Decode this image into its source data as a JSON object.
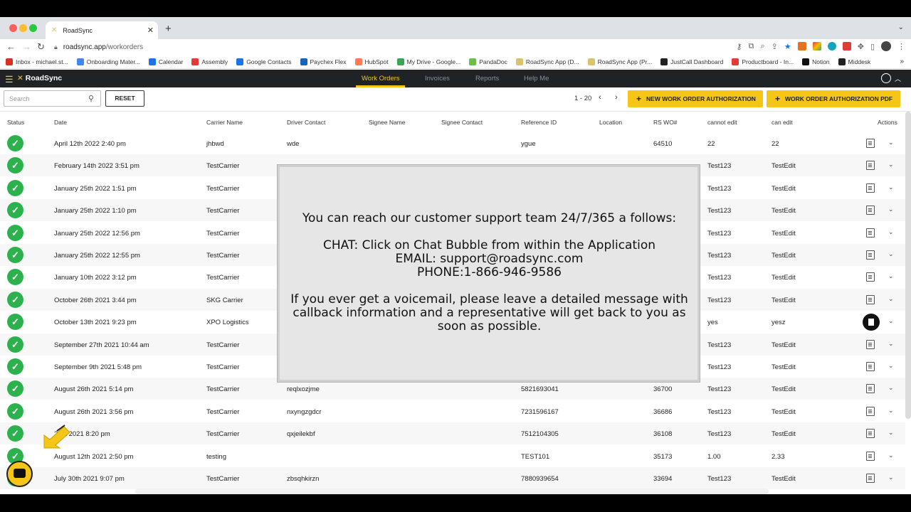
{
  "browser": {
    "tab_title": "RoadSync",
    "url_host": "roadsync.app",
    "url_path": "/workorders",
    "bookmarks": [
      {
        "label": "Inbox - michael.st...",
        "color": "#d93025"
      },
      {
        "label": "Onboarding Mater...",
        "color": "#4285f4"
      },
      {
        "label": "Calendar",
        "color": "#1a73e8"
      },
      {
        "label": "Assembly",
        "color": "#e53935"
      },
      {
        "label": "Google Contacts",
        "color": "#1a73e8"
      },
      {
        "label": "Paychex Flex",
        "color": "#1565c0"
      },
      {
        "label": "HubSpot",
        "color": "#ff7a59"
      },
      {
        "label": "My Drive - Google...",
        "color": "#34a853"
      },
      {
        "label": "PandaDoc",
        "color": "#6abf4b"
      },
      {
        "label": "RoadSync App (D...",
        "color": "#d9c46b"
      },
      {
        "label": "RoadSync App (Pr...",
        "color": "#d9c46b"
      },
      {
        "label": "JustCall Dashboard",
        "color": "#222222"
      },
      {
        "label": "Productboard - In...",
        "color": "#e53935"
      },
      {
        "label": "Notion",
        "color": "#111111"
      },
      {
        "label": "Middesk",
        "color": "#222222"
      }
    ]
  },
  "app": {
    "brand": "RoadSync",
    "nav": [
      "Work Orders",
      "Invoices",
      "Reports",
      "Help Me"
    ],
    "active_nav": "Work Orders",
    "accent": "#f5c518"
  },
  "toolbar": {
    "search_placeholder": "Search",
    "reset_label": "RESET",
    "pager": "1 - 20",
    "new_wo_label": "NEW WORK ORDER AUTHORIZATION",
    "wo_pdf_label": "WORK ORDER AUTHORIZATION PDF"
  },
  "table": {
    "columns": [
      "Status",
      "Date",
      "Carrier Name",
      "Driver Contact",
      "Signee Name",
      "Signee Contact",
      "Reference ID",
      "Location",
      "RS WO#",
      "cannot edit",
      "can edit",
      "Actions"
    ],
    "rows": [
      {
        "date": "April 12th 2022 2:40 pm",
        "carrier": "jhbwd",
        "driver": "wde",
        "ref": "ygue",
        "wo": "64510",
        "cannot": "22",
        "can": "22"
      },
      {
        "date": "February 14th 2022 3:51 pm",
        "carrier": "TestCarrier",
        "driver": "",
        "ref": "",
        "wo": "",
        "cannot": "Test123",
        "can": "TestEdit"
      },
      {
        "date": "January 25th 2022 1:51 pm",
        "carrier": "TestCarrier",
        "driver": "",
        "ref": "",
        "wo": "",
        "cannot": "Test123",
        "can": "TestEdit"
      },
      {
        "date": "January 25th 2022 1:10 pm",
        "carrier": "TestCarrier",
        "driver": "",
        "ref": "",
        "wo": "",
        "cannot": "Test123",
        "can": "TestEdit"
      },
      {
        "date": "January 25th 2022 12:56 pm",
        "carrier": "TestCarrier",
        "driver": "",
        "ref": "",
        "wo": "",
        "cannot": "Test123",
        "can": "TestEdit"
      },
      {
        "date": "January 25th 2022 12:55 pm",
        "carrier": "TestCarrier",
        "driver": "",
        "ref": "",
        "wo": "",
        "cannot": "Test123",
        "can": "TestEdit"
      },
      {
        "date": "January 10th 2022 3:12 pm",
        "carrier": "TestCarrier",
        "driver": "",
        "ref": "",
        "wo": "",
        "cannot": "Test123",
        "can": "TestEdit"
      },
      {
        "date": "October 26th 2021 3:44 pm",
        "carrier": "SKG Carrier",
        "driver": "",
        "ref": "",
        "wo": "",
        "cannot": "Test123",
        "can": "TestEdit"
      },
      {
        "date": "October 13th 2021 9:23 pm",
        "carrier": "XPO Logistics",
        "driver": "",
        "ref": "",
        "wo": "",
        "cannot": "yes",
        "can": "yesz"
      },
      {
        "date": "September 27th 2021 10:44 am",
        "carrier": "TestCarrier",
        "driver": "",
        "ref": "",
        "wo": "",
        "cannot": "Test123",
        "can": "TestEdit"
      },
      {
        "date": "September 9th 2021 5:48 pm",
        "carrier": "TestCarrier",
        "driver": "",
        "ref": "",
        "wo": "",
        "cannot": "Test123",
        "can": "TestEdit"
      },
      {
        "date": "August 26th 2021 5:14 pm",
        "carrier": "TestCarrier",
        "driver": "reqlxozjme",
        "ref": "5821693041",
        "wo": "36700",
        "cannot": "Test123",
        "can": "TestEdit"
      },
      {
        "date": "August 26th 2021 3:56 pm",
        "carrier": "TestCarrier",
        "driver": "nxyngzgdcr",
        "ref": "7231596167",
        "wo": "36686",
        "cannot": "Test123",
        "can": "TestEdit"
      },
      {
        "date": "21st 2021 8:20 pm",
        "carrier": "TestCarrier",
        "driver": "qxjeilekbf",
        "ref": "7512104305",
        "wo": "36108",
        "cannot": "Test123",
        "can": "TestEdit"
      },
      {
        "date": "August 12th 2021 2:50 pm",
        "carrier": "testing",
        "driver": "",
        "ref": "TEST101",
        "wo": "35173",
        "cannot": "1.00",
        "can": "2.33"
      },
      {
        "date": "July 30th 2021 9:07 pm",
        "carrier": "TestCarrier",
        "driver": "zbsqhkirzn",
        "ref": "7880939654",
        "wo": "33694",
        "cannot": "Test123",
        "can": "TestEdit"
      }
    ]
  },
  "modal": {
    "line1": "You can reach our customer support team 24/7/365 a follows:",
    "line2": "CHAT: Click on Chat Bubble from within the Application",
    "line3": "EMAIL: support@roadsync.com",
    "line4": "PHONE:1-866-946-9586",
    "line5": "If you ever get a voicemail, please leave a detailed message with callback information and a representative will get back to you as soon as possible."
  }
}
